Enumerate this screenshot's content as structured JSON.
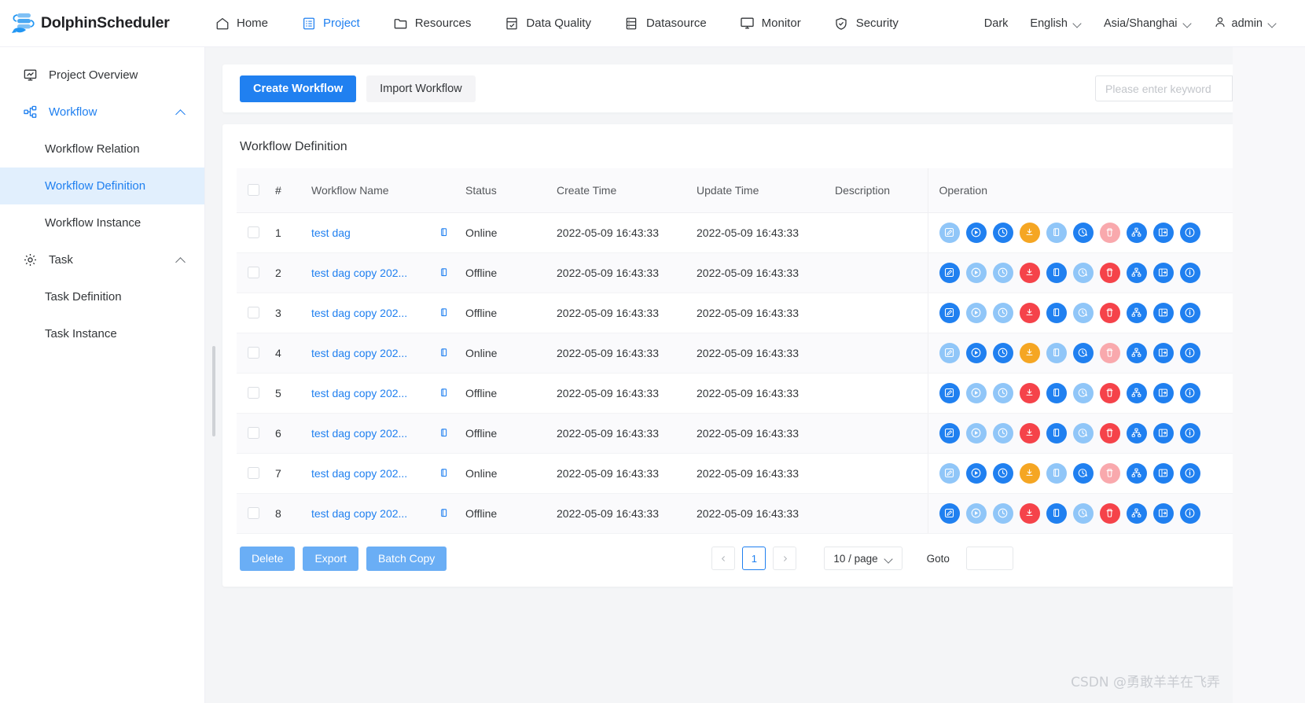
{
  "header": {
    "brand": "DolphinScheduler",
    "nav": [
      {
        "label": "Home",
        "icon": "home-icon",
        "active": false
      },
      {
        "label": "Project",
        "icon": "project-icon",
        "active": true
      },
      {
        "label": "Resources",
        "icon": "folder-icon",
        "active": false
      },
      {
        "label": "Data Quality",
        "icon": "data-quality-icon",
        "active": false
      },
      {
        "label": "Datasource",
        "icon": "database-icon",
        "active": false
      },
      {
        "label": "Monitor",
        "icon": "monitor-icon",
        "active": false
      },
      {
        "label": "Security",
        "icon": "shield-icon",
        "active": false
      }
    ],
    "theme": "Dark",
    "language": "English",
    "timezone": "Asia/Shanghai",
    "user": "admin"
  },
  "sidebar": {
    "items": [
      {
        "label": "Project Overview",
        "icon": "overview-icon",
        "level": "top",
        "state": "normal"
      },
      {
        "label": "Workflow",
        "icon": "workflow-icon",
        "level": "top",
        "state": "expanded"
      },
      {
        "label": "Workflow Relation",
        "icon": "",
        "level": "sub",
        "state": "normal"
      },
      {
        "label": "Workflow Definition",
        "icon": "",
        "level": "sub",
        "state": "selected"
      },
      {
        "label": "Workflow Instance",
        "icon": "",
        "level": "sub",
        "state": "normal"
      },
      {
        "label": "Task",
        "icon": "gear-icon",
        "level": "top",
        "state": "expanded-dark"
      },
      {
        "label": "Task Definition",
        "icon": "",
        "level": "sub",
        "state": "normal"
      },
      {
        "label": "Task Instance",
        "icon": "",
        "level": "sub",
        "state": "normal"
      }
    ]
  },
  "toolbar": {
    "create_label": "Create Workflow",
    "import_label": "Import Workflow",
    "search_placeholder": "Please enter keyword",
    "search_value": "",
    "search_icon": "search-icon"
  },
  "table": {
    "title": "Workflow Definition",
    "columns": [
      "#",
      "Workflow Name",
      "Status",
      "Create Time",
      "Update Time",
      "Description",
      "Operation"
    ],
    "rows": [
      {
        "idx": "1",
        "name": "test dag",
        "status": "Online",
        "create_time": "2022-05-09 16:43:33",
        "update_time": "2022-05-09 16:43:33",
        "description": ""
      },
      {
        "idx": "2",
        "name": "test dag copy 202...",
        "status": "Offline",
        "create_time": "2022-05-09 16:43:33",
        "update_time": "2022-05-09 16:43:33",
        "description": ""
      },
      {
        "idx": "3",
        "name": "test dag copy 202...",
        "status": "Offline",
        "create_time": "2022-05-09 16:43:33",
        "update_time": "2022-05-09 16:43:33",
        "description": ""
      },
      {
        "idx": "4",
        "name": "test dag copy 202...",
        "status": "Online",
        "create_time": "2022-05-09 16:43:33",
        "update_time": "2022-05-09 16:43:33",
        "description": ""
      },
      {
        "idx": "5",
        "name": "test dag copy 202...",
        "status": "Offline",
        "create_time": "2022-05-09 16:43:33",
        "update_time": "2022-05-09 16:43:33",
        "description": ""
      },
      {
        "idx": "6",
        "name": "test dag copy 202...",
        "status": "Offline",
        "create_time": "2022-05-09 16:43:33",
        "update_time": "2022-05-09 16:43:33",
        "description": ""
      },
      {
        "idx": "7",
        "name": "test dag copy 202...",
        "status": "Online",
        "create_time": "2022-05-09 16:43:33",
        "update_time": "2022-05-09 16:43:33",
        "description": ""
      },
      {
        "idx": "8",
        "name": "test dag copy 202...",
        "status": "Offline",
        "create_time": "2022-05-09 16:43:33",
        "update_time": "2022-05-09 16:43:33",
        "description": ""
      }
    ],
    "operations": [
      {
        "name": "edit",
        "icon": "edit-icon"
      },
      {
        "name": "start",
        "icon": "play-icon"
      },
      {
        "name": "timing",
        "icon": "clock-icon"
      },
      {
        "name": "release",
        "icon": "download-icon"
      },
      {
        "name": "copy",
        "icon": "copy-icon"
      },
      {
        "name": "cron",
        "icon": "clock-arrow-icon"
      },
      {
        "name": "delete",
        "icon": "trash-icon"
      },
      {
        "name": "tree-view",
        "icon": "tree-icon"
      },
      {
        "name": "export",
        "icon": "export-icon"
      },
      {
        "name": "version",
        "icon": "info-icon"
      }
    ],
    "row_copy_icon": "copy-icon"
  },
  "footer": {
    "delete_label": "Delete",
    "export_label": "Export",
    "batch_copy_label": "Batch Copy",
    "prev_icon": "chevron-left-icon",
    "next_icon": "chevron-right-icon",
    "current_page": "1",
    "page_size": "10 / page",
    "goto_label": "Goto",
    "goto_value": ""
  },
  "watermark": "CSDN @勇敢羊羊在飞弄",
  "colors": {
    "primary": "#2080f0",
    "primary_light": "#90c6f8",
    "orange": "#f5a623",
    "red": "#f5434a",
    "red_light": "#f9a9ad",
    "selected_bg": "#e1effd"
  }
}
